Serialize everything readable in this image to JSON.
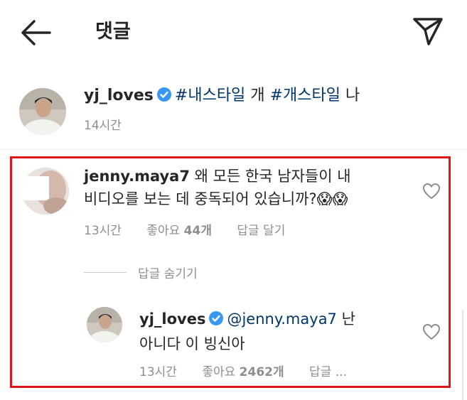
{
  "header": {
    "title": "댓글"
  },
  "caption": {
    "username": "yj_loves",
    "tag1": "#내스타일",
    "word1": "개",
    "tag2": "#개스타일",
    "word2": "나",
    "time": "14시간"
  },
  "comment": {
    "username": "jenny.maya7",
    "text_line1": "왜 모든 한국 남자들이 내",
    "text_line2": "비디오를 보는 데 중독되어 있습니까?",
    "emoji": "😱😱",
    "time": "13시간",
    "likes_label": "좋아요",
    "likes_count": "44개",
    "reply_label": "답글 달기"
  },
  "hide_replies": "답글 숨기기",
  "reply": {
    "username": "yj_loves",
    "mention": "@jenny.maya7",
    "text_after_mention": "난",
    "text_line2": "아니다 이 빙신아",
    "time": "13시간",
    "likes_label": "좋아요",
    "likes_count": "2462개",
    "reply_label": "답글 ..."
  },
  "colors": {
    "verified": "#3897f0",
    "link": "#00376b",
    "highlight_border": "#e0151c",
    "muted": "#8e8e8e"
  },
  "icons": [
    "back-arrow-icon",
    "send-icon",
    "verified-badge-icon",
    "heart-icon"
  ]
}
